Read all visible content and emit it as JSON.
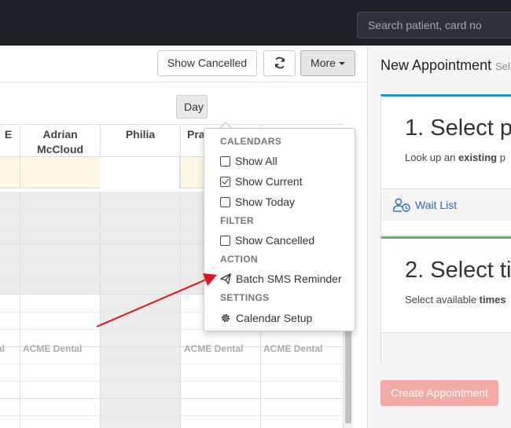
{
  "search": {
    "placeholder": "Search patient, card no"
  },
  "toolbar": {
    "show_cancelled": "Show Cancelled",
    "more": "More"
  },
  "view": {
    "day": "Day"
  },
  "calendar": {
    "columns": [
      {
        "name": "E"
      },
      {
        "name": "Adrian McCloud"
      },
      {
        "name": "Philia"
      },
      {
        "name": "Pra"
      }
    ],
    "location_labels": [
      "al",
      "ACME Dental",
      "ACME Dental",
      "ACME Dental"
    ]
  },
  "dropdown": {
    "sections": [
      {
        "header": "CALENDARS",
        "items": [
          {
            "label": "Show All",
            "icon": "checkbox-empty-icon"
          },
          {
            "label": "Show Current",
            "icon": "checkbox-checked-icon"
          },
          {
            "label": "Show Today",
            "icon": "checkbox-empty-icon"
          }
        ]
      },
      {
        "header": "FILTER",
        "items": [
          {
            "label": "Show Cancelled",
            "icon": "checkbox-empty-icon"
          }
        ]
      },
      {
        "header": "ACTION",
        "items": [
          {
            "label": "Batch SMS Reminder",
            "icon": "paper-plane-icon"
          }
        ]
      },
      {
        "header": "SETTINGS",
        "items": [
          {
            "label": "Calendar Setup",
            "icon": "gear-icon"
          }
        ]
      }
    ]
  },
  "right_panel": {
    "title": "New Appointment",
    "title_sub": "Sel",
    "step1": {
      "title": "1. Select p",
      "text_prefix": "Look up an ",
      "text_bold": "existing",
      "text_suffix": " p"
    },
    "wait_list": "Wait List",
    "step2": {
      "title": "2. Select ti",
      "text_prefix": "Select available ",
      "text_bold": "times"
    },
    "create_button": "Create Appointment"
  },
  "colors": {
    "topbar": "#1f2328",
    "allday_bg": "#fcf8e3",
    "step1_accent": "#2a8fd8",
    "step2_accent": "#5cb85c",
    "create_btn": "#f4a9a6",
    "annotation_arrow": "#e8121a"
  }
}
